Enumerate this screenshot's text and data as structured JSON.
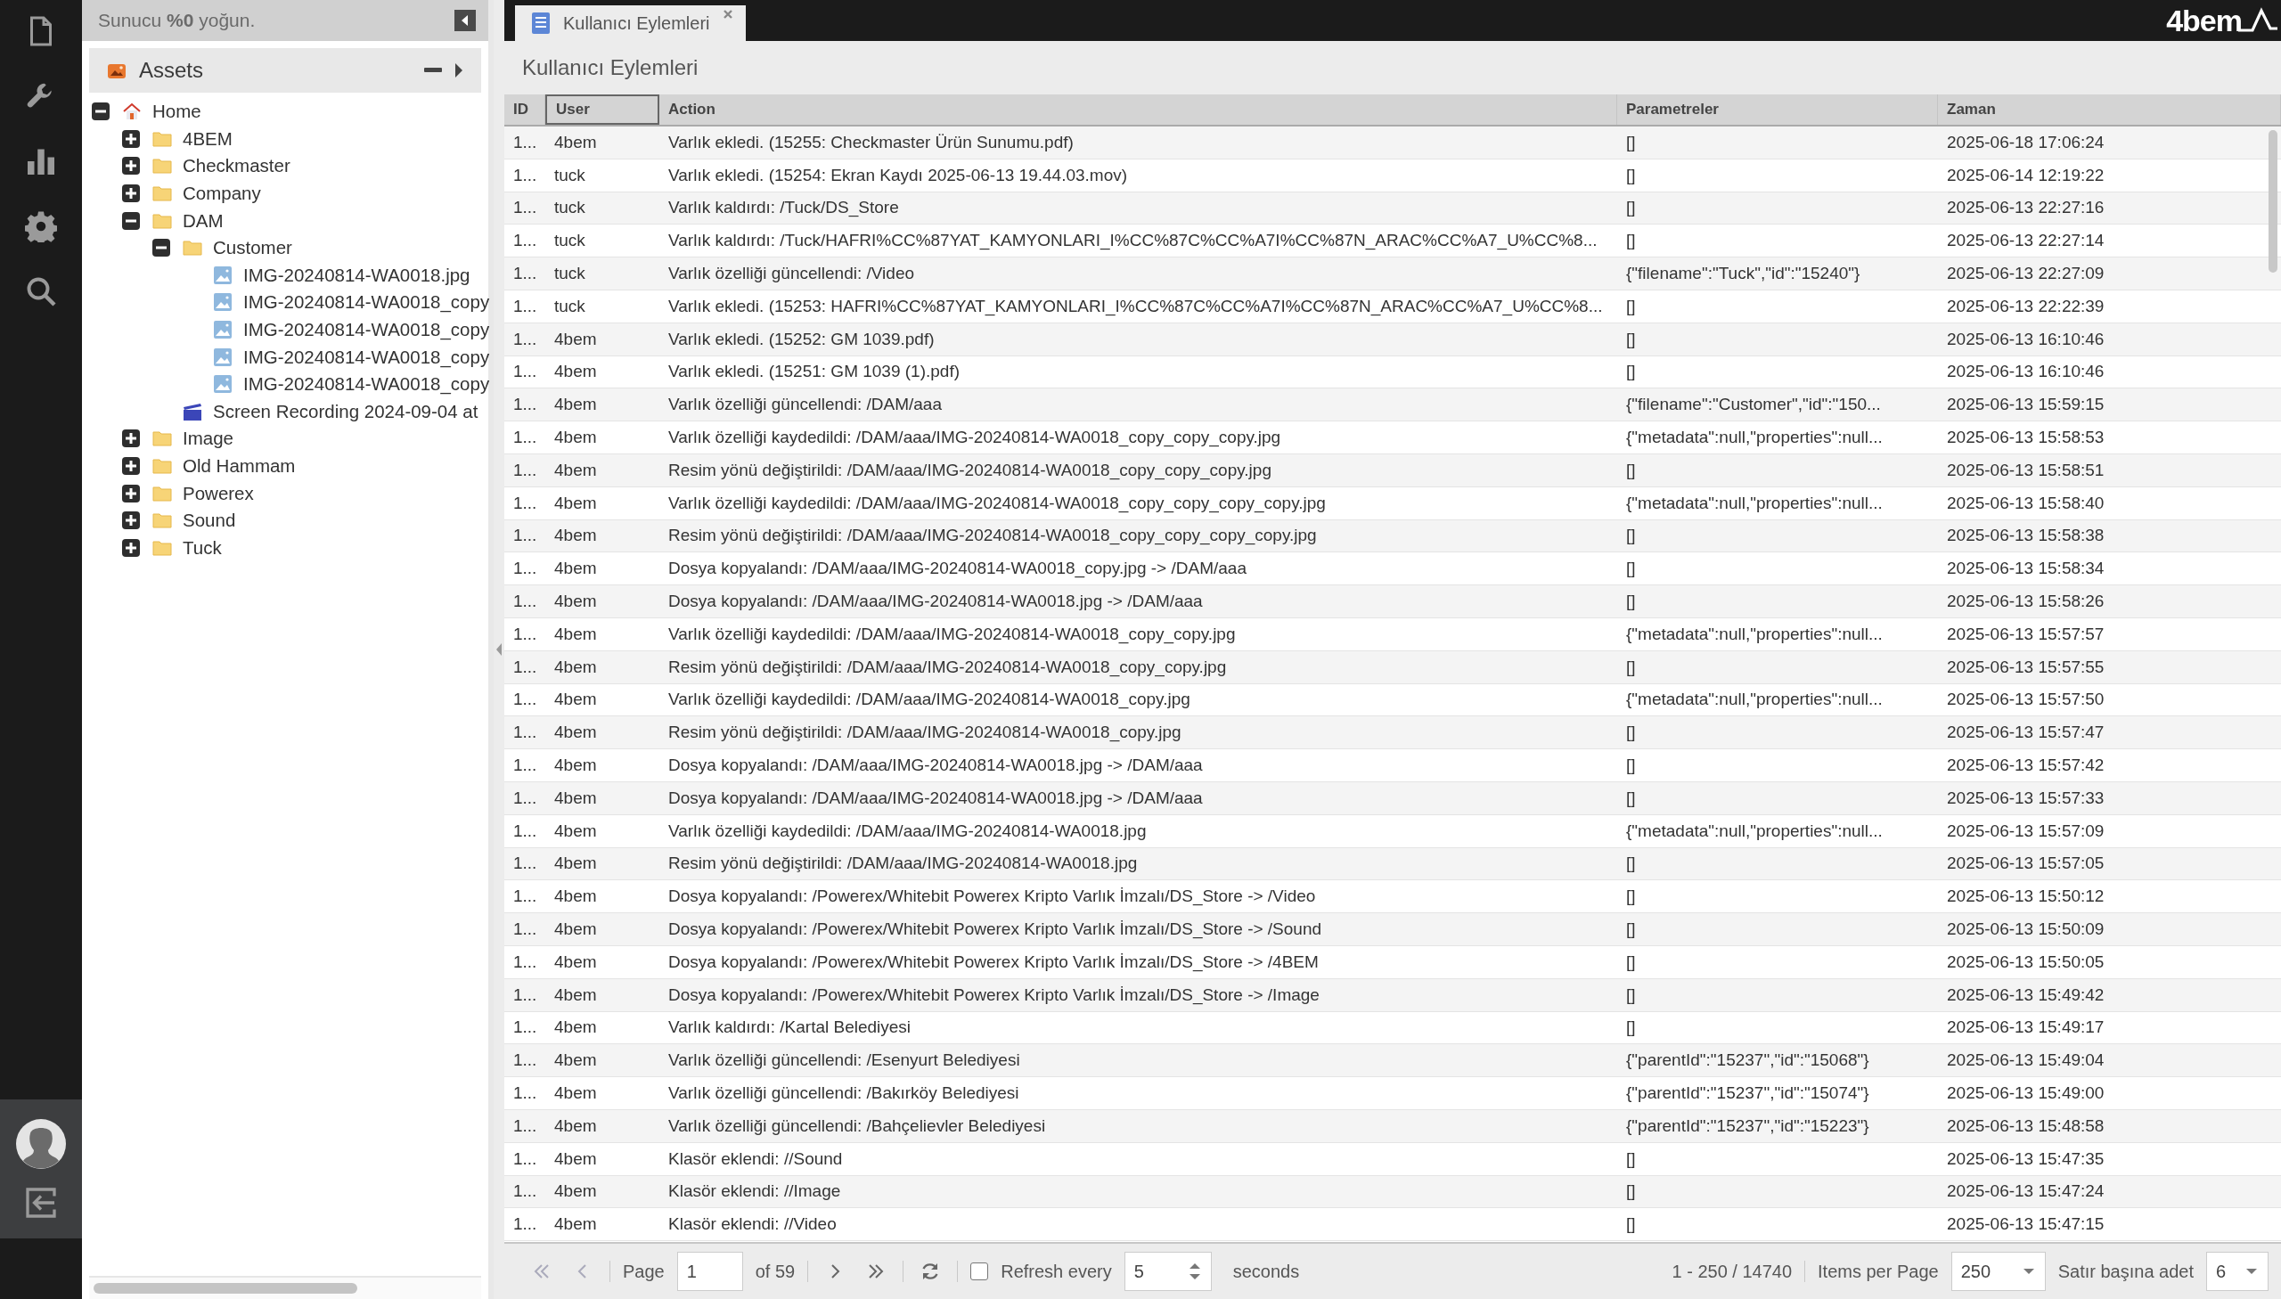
{
  "server_status": "Sunucu **%0** yoğun.",
  "tree": {
    "title": "Assets",
    "nodes": [
      {
        "label": "Home",
        "kind": "home",
        "expanded": true,
        "children": [
          {
            "label": "4BEM",
            "kind": "folder",
            "expanded": false
          },
          {
            "label": "Checkmaster",
            "kind": "folder",
            "expanded": false
          },
          {
            "label": "Company",
            "kind": "folder",
            "expanded": false
          },
          {
            "label": "DAM",
            "kind": "folder",
            "expanded": true,
            "children": [
              {
                "label": "Customer",
                "kind": "folder",
                "expanded": true,
                "children": [
                  {
                    "label": "IMG-20240814-WA0018.jpg",
                    "kind": "image"
                  },
                  {
                    "label": "IMG-20240814-WA0018_copy",
                    "kind": "image"
                  },
                  {
                    "label": "IMG-20240814-WA0018_copy",
                    "kind": "image"
                  },
                  {
                    "label": "IMG-20240814-WA0018_copy",
                    "kind": "image"
                  },
                  {
                    "label": "IMG-20240814-WA0018_copy",
                    "kind": "image"
                  }
                ]
              },
              {
                "label": "Screen Recording 2024-09-04 at",
                "kind": "video"
              }
            ]
          },
          {
            "label": "Image",
            "kind": "folder",
            "expanded": false
          },
          {
            "label": "Old Hammam",
            "kind": "folder",
            "expanded": false
          },
          {
            "label": "Powerex",
            "kind": "folder",
            "expanded": false
          },
          {
            "label": "Sound",
            "kind": "folder",
            "expanded": false
          },
          {
            "label": "Tuck",
            "kind": "folder",
            "expanded": false
          }
        ]
      }
    ]
  },
  "tabs": [
    {
      "label": "Kullanıcı Eylemleri",
      "selected": true
    }
  ],
  "logo": "4bem",
  "panel_title": "Kullanıcı Eylemleri",
  "table": {
    "columns": [
      {
        "label": "ID",
        "selected": false
      },
      {
        "label": "User",
        "selected": true
      },
      {
        "label": "Action",
        "selected": false
      },
      {
        "label": "Parametreler",
        "selected": false
      },
      {
        "label": "Zaman",
        "selected": false
      }
    ],
    "rows": [
      [
        "1...",
        "4bem",
        "Varlık ekledi. (15255: Checkmaster Ürün Sunumu.pdf)",
        "[]",
        "2025-06-18 17:06:24"
      ],
      [
        "1...",
        "tuck",
        "Varlık ekledi. (15254: Ekran Kaydı 2025-06-13 19.44.03.mov)",
        "[]",
        "2025-06-14 12:19:22"
      ],
      [
        "1...",
        "tuck",
        "Varlık kaldırdı: /Tuck/DS_Store",
        "[]",
        "2025-06-13 22:27:16"
      ],
      [
        "1...",
        "tuck",
        "Varlık kaldırdı: /Tuck/HAFRI%CC%87YAT_KAMYONLARI_I%CC%87C%CC%A7I%CC%87N_ARAC%CC%A7_U%CC%8...",
        "[]",
        "2025-06-13 22:27:14"
      ],
      [
        "1...",
        "tuck",
        "Varlık özelliği güncellendi: /Video",
        "{\"filename\":\"Tuck\",\"id\":\"15240\"}",
        "2025-06-13 22:27:09"
      ],
      [
        "1...",
        "tuck",
        "Varlık ekledi. (15253: HAFRI%CC%87YAT_KAMYONLARI_I%CC%87C%CC%A7I%CC%87N_ARAC%CC%A7_U%CC%8...",
        "[]",
        "2025-06-13 22:22:39"
      ],
      [
        "1...",
        "4bem",
        "Varlık ekledi. (15252: GM 1039.pdf)",
        "[]",
        "2025-06-13 16:10:46"
      ],
      [
        "1...",
        "4bem",
        "Varlık ekledi. (15251: GM 1039 (1).pdf)",
        "[]",
        "2025-06-13 16:10:46"
      ],
      [
        "1...",
        "4bem",
        "Varlık özelliği güncellendi: /DAM/aaa",
        "{\"filename\":\"Customer\",\"id\":\"150...",
        "2025-06-13 15:59:15"
      ],
      [
        "1...",
        "4bem",
        "Varlık özelliği kaydedildi: /DAM/aaa/IMG-20240814-WA0018_copy_copy_copy.jpg",
        "{\"metadata\":null,\"properties\":null...",
        "2025-06-13 15:58:53"
      ],
      [
        "1...",
        "4bem",
        "Resim yönü değiştirildi: /DAM/aaa/IMG-20240814-WA0018_copy_copy_copy.jpg",
        "[]",
        "2025-06-13 15:58:51"
      ],
      [
        "1...",
        "4bem",
        "Varlık özelliği kaydedildi: /DAM/aaa/IMG-20240814-WA0018_copy_copy_copy_copy.jpg",
        "{\"metadata\":null,\"properties\":null...",
        "2025-06-13 15:58:40"
      ],
      [
        "1...",
        "4bem",
        "Resim yönü değiştirildi: /DAM/aaa/IMG-20240814-WA0018_copy_copy_copy_copy.jpg",
        "[]",
        "2025-06-13 15:58:38"
      ],
      [
        "1...",
        "4bem",
        "Dosya kopyalandı: /DAM/aaa/IMG-20240814-WA0018_copy.jpg -> /DAM/aaa",
        "[]",
        "2025-06-13 15:58:34"
      ],
      [
        "1...",
        "4bem",
        "Dosya kopyalandı: /DAM/aaa/IMG-20240814-WA0018.jpg -> /DAM/aaa",
        "[]",
        "2025-06-13 15:58:26"
      ],
      [
        "1...",
        "4bem",
        "Varlık özelliği kaydedildi: /DAM/aaa/IMG-20240814-WA0018_copy_copy.jpg",
        "{\"metadata\":null,\"properties\":null...",
        "2025-06-13 15:57:57"
      ],
      [
        "1...",
        "4bem",
        "Resim yönü değiştirildi: /DAM/aaa/IMG-20240814-WA0018_copy_copy.jpg",
        "[]",
        "2025-06-13 15:57:55"
      ],
      [
        "1...",
        "4bem",
        "Varlık özelliği kaydedildi: /DAM/aaa/IMG-20240814-WA0018_copy.jpg",
        "{\"metadata\":null,\"properties\":null...",
        "2025-06-13 15:57:50"
      ],
      [
        "1...",
        "4bem",
        "Resim yönü değiştirildi: /DAM/aaa/IMG-20240814-WA0018_copy.jpg",
        "[]",
        "2025-06-13 15:57:47"
      ],
      [
        "1...",
        "4bem",
        "Dosya kopyalandı: /DAM/aaa/IMG-20240814-WA0018.jpg -> /DAM/aaa",
        "[]",
        "2025-06-13 15:57:42"
      ],
      [
        "1...",
        "4bem",
        "Dosya kopyalandı: /DAM/aaa/IMG-20240814-WA0018.jpg -> /DAM/aaa",
        "[]",
        "2025-06-13 15:57:33"
      ],
      [
        "1...",
        "4bem",
        "Varlık özelliği kaydedildi: /DAM/aaa/IMG-20240814-WA0018.jpg",
        "{\"metadata\":null,\"properties\":null...",
        "2025-06-13 15:57:09"
      ],
      [
        "1...",
        "4bem",
        "Resim yönü değiştirildi: /DAM/aaa/IMG-20240814-WA0018.jpg",
        "[]",
        "2025-06-13 15:57:05"
      ],
      [
        "1...",
        "4bem",
        "Dosya kopyalandı: /Powerex/Whitebit Powerex Kripto Varlık İmzalı/DS_Store -> /Video",
        "[]",
        "2025-06-13 15:50:12"
      ],
      [
        "1...",
        "4bem",
        "Dosya kopyalandı: /Powerex/Whitebit Powerex Kripto Varlık İmzalı/DS_Store -> /Sound",
        "[]",
        "2025-06-13 15:50:09"
      ],
      [
        "1...",
        "4bem",
        "Dosya kopyalandı: /Powerex/Whitebit Powerex Kripto Varlık İmzalı/DS_Store -> /4BEM",
        "[]",
        "2025-06-13 15:50:05"
      ],
      [
        "1...",
        "4bem",
        "Dosya kopyalandı: /Powerex/Whitebit Powerex Kripto Varlık İmzalı/DS_Store -> /Image",
        "[]",
        "2025-06-13 15:49:42"
      ],
      [
        "1...",
        "4bem",
        "Varlık kaldırdı: /Kartal Belediyesi",
        "[]",
        "2025-06-13 15:49:17"
      ],
      [
        "1...",
        "4bem",
        "Varlık özelliği güncellendi: /Esenyurt Belediyesi",
        "{\"parentId\":\"15237\",\"id\":\"15068\"}",
        "2025-06-13 15:49:04"
      ],
      [
        "1...",
        "4bem",
        "Varlık özelliği güncellendi: /Bakırköy Belediyesi",
        "{\"parentId\":\"15237\",\"id\":\"15074\"}",
        "2025-06-13 15:49:00"
      ],
      [
        "1...",
        "4bem",
        "Varlık özelliği güncellendi: /Bahçelievler Belediyesi",
        "{\"parentId\":\"15237\",\"id\":\"15223\"}",
        "2025-06-13 15:48:58"
      ],
      [
        "1...",
        "4bem",
        "Klasör eklendi: //Sound",
        "[]",
        "2025-06-13 15:47:35"
      ],
      [
        "1...",
        "4bem",
        "Klasör eklendi: //Image",
        "[]",
        "2025-06-13 15:47:24"
      ],
      [
        "1...",
        "4bem",
        "Klasör eklendi: //Video",
        "[]",
        "2025-06-13 15:47:15"
      ]
    ]
  },
  "pager": {
    "page_label": "Page",
    "page": "1",
    "of": "of 59",
    "refresh_checked": false,
    "refresh_label": "Refresh every",
    "refresh_value": "5",
    "seconds": "seconds",
    "range": "1 - 250 / 14740",
    "items_label": "Items per Page",
    "items_value": "250",
    "per_row_label": "Satır başına adet",
    "per_row_value": "6"
  }
}
